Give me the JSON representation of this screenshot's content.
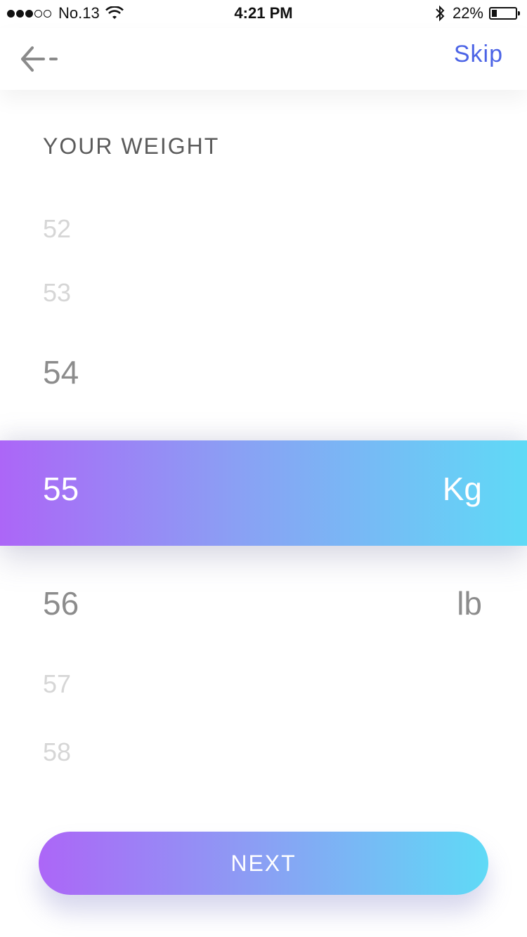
{
  "status_bar": {
    "carrier": "No.13",
    "time": "4:21 PM",
    "battery_text": "22%",
    "battery_level": 0.22,
    "signal_strength": 3,
    "signal_max": 5
  },
  "nav": {
    "back_icon": "arrow-left-icon",
    "skip_label": "Skip"
  },
  "title": "YOUR WEIGHT",
  "picker": {
    "values": [
      "52",
      "53",
      "54",
      "55",
      "56",
      "57",
      "58"
    ],
    "selected": "55",
    "units": [
      "Kg",
      "lb"
    ],
    "selected_unit": "Kg"
  },
  "next_label": "NEXT",
  "colors": {
    "accent": "#4c64e6",
    "gradient_start": "#ac66f7",
    "gradient_end": "#5fdaf6"
  }
}
